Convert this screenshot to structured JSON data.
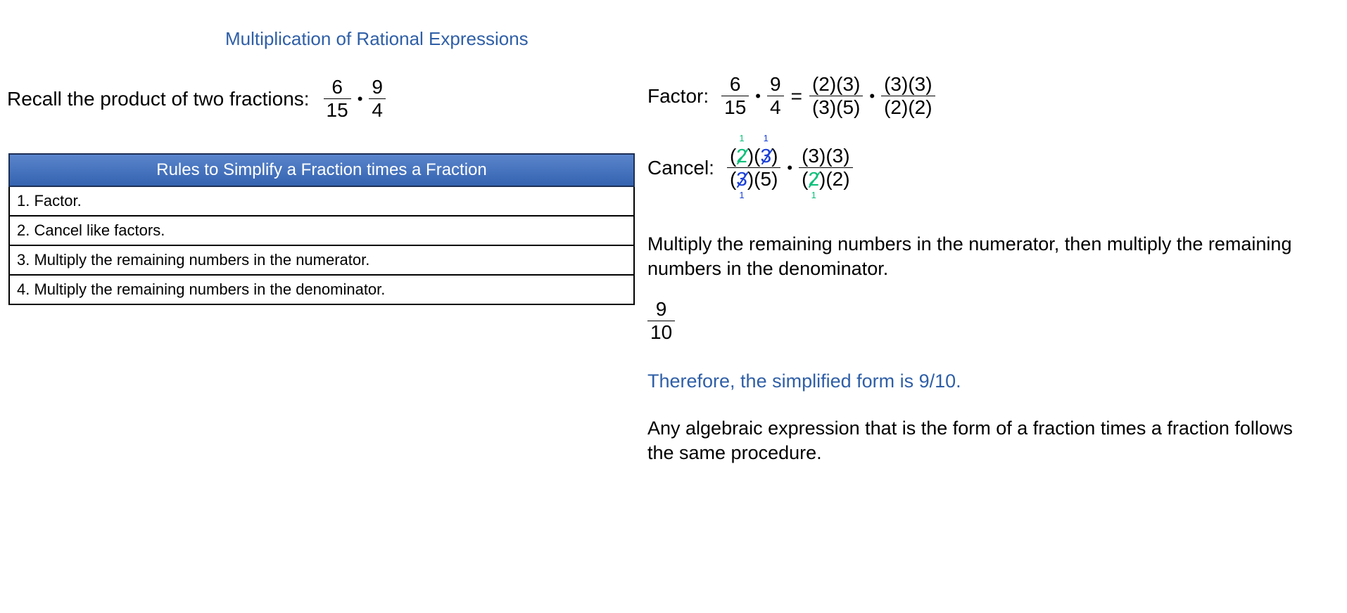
{
  "title": "Multiplication of Rational Expressions",
  "recall": {
    "label": "Recall the product of two fractions:",
    "f1_num": "6",
    "f1_den": "15",
    "f2_num": "9",
    "f2_den": "4",
    "dot": "•"
  },
  "rules": {
    "header": "Rules to Simplify a Fraction times a Fraction",
    "items": [
      "1.  Factor.",
      "2.  Cancel like factors.",
      "3.  Multiply the remaining numbers in the numerator.",
      "4.  Multiply the remaining numbers in the denominator."
    ]
  },
  "factor": {
    "label": "Factor:",
    "f1_num": "6",
    "f1_den": "15",
    "f2_num": "9",
    "f2_den": "4",
    "equals": "=",
    "g1_num": "(2)(3)",
    "g1_den": "(3)(5)",
    "g2_num": "(3)(3)",
    "g2_den": "(2)(2)",
    "dot": "•"
  },
  "cancel": {
    "label": "Cancel:",
    "p_open": "(",
    "p_close": ")",
    "two": "2",
    "three": "3",
    "five": "5",
    "one": "1",
    "g2_num": "(3)(3)",
    "dot": "•",
    "colors": {
      "green": "#0bbf7a",
      "blue": "#1a3fd6"
    }
  },
  "multiply_text": "Multiply the remaining numbers in the numerator, then multiply the remaining numbers in the denominator.",
  "result": {
    "num": "9",
    "den": "10"
  },
  "therefore": "Therefore, the simplified form is 9/10.",
  "closing": "Any algebraic expression that is the form of a fraction times a fraction follows the same procedure.",
  "colors": {
    "title": "#2f5fa7",
    "table_header": "#3563b0"
  }
}
